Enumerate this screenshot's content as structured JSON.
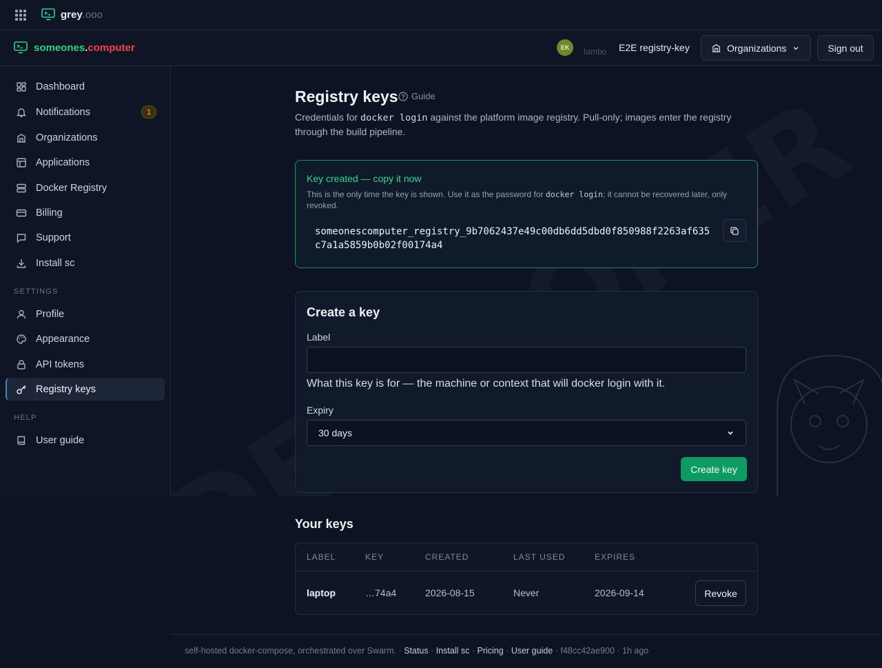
{
  "topbar": {
    "name": "grey",
    "tld": ".ooo"
  },
  "header": {
    "brand_a": "someones",
    "brand_b": ".",
    "brand_c": "computer",
    "avatar_initials": "EK",
    "user_sub": "Iambo",
    "org_label": "E2E registry-key",
    "org_button": "Organizations",
    "signout": "Sign out"
  },
  "sidebar": {
    "items": [
      {
        "label": "Dashboard",
        "icon": "dashboard-icon"
      },
      {
        "label": "Notifications",
        "icon": "bell-icon",
        "badge": "1"
      },
      {
        "label": "Organizations",
        "icon": "building-icon"
      },
      {
        "label": "Applications",
        "icon": "layout-icon"
      },
      {
        "label": "Docker Registry",
        "icon": "server-icon"
      },
      {
        "label": "Billing",
        "icon": "credit-card-icon"
      },
      {
        "label": "Support",
        "icon": "message-icon"
      },
      {
        "label": "Install sc",
        "icon": "download-icon"
      }
    ],
    "settings_heading": "SETTINGS",
    "settings": [
      {
        "label": "Profile",
        "icon": "user-icon"
      },
      {
        "label": "Appearance",
        "icon": "palette-icon"
      },
      {
        "label": "API tokens",
        "icon": "lock-icon"
      },
      {
        "label": "Registry keys",
        "icon": "key-icon",
        "active": true
      }
    ],
    "help_heading": "HELP",
    "help": [
      {
        "label": "User guide",
        "icon": "book-icon"
      }
    ]
  },
  "main": {
    "title": "Registry keys",
    "guide": "Guide",
    "desc_1": "Credentials for ",
    "desc_code": "docker login",
    "desc_2": " against the platform image registry. Pull-only; images enter the registry through the build pipeline."
  },
  "created": {
    "title": "Key created — copy it now",
    "note_1": "This is the only time the key is shown. Use it as the password for ",
    "note_code": "docker login",
    "note_2": "; it cannot be recovered later, only revoked.",
    "key": "someonescomputer_registry_9b7062437e49c00db6dd5dbd0f850988f2263af635c7a1a5859b0b02f00174a4"
  },
  "create": {
    "title": "Create a key",
    "label_label": "Label",
    "label_value": "",
    "hint": "What this key is for — the machine or context that will docker login with it.",
    "expiry_label": "Expiry",
    "expiry_value": "30 days",
    "button": "Create key"
  },
  "keys": {
    "title": "Your keys",
    "headers": [
      "LABEL",
      "KEY",
      "CREATED",
      "LAST USED",
      "EXPIRES"
    ],
    "rows": [
      {
        "label": "laptop",
        "key": "…74a4",
        "created": "2026-08-15",
        "last_used": "Never",
        "expires": "2026-09-14",
        "action": "Revoke"
      }
    ]
  },
  "footer": {
    "text": "self-hosted docker-compose, orchestrated over Swarm. · ",
    "links": [
      "Status",
      "Install sc",
      "Pricing",
      "User guide"
    ],
    "sep": " · ",
    "commit": "f48cc42ae900",
    "ago": "1h ago"
  }
}
